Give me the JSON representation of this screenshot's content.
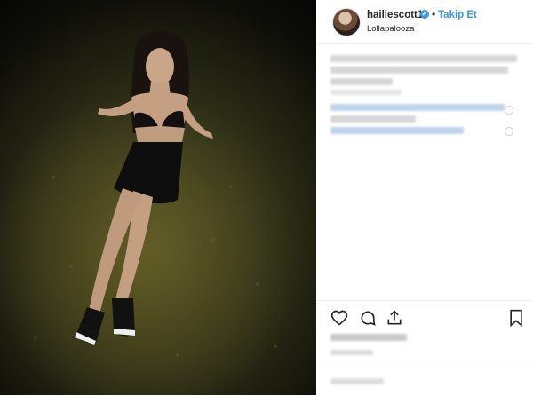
{
  "post": {
    "photo_alt": "photo-of-woman-sitting-on-grass",
    "header": {
      "username": "hailiescott1",
      "verified_badge": "✔",
      "separator": "•",
      "follow_label": "Takip Et",
      "location": "Lollapalooza"
    },
    "icons": {
      "verified": "verified-badge-icon",
      "like": "heart-icon",
      "comment": "comment-icon",
      "share": "share-icon",
      "save": "bookmark-icon"
    },
    "colors": {
      "accent": "#3897f0",
      "text": "#262626",
      "divider": "#efefef"
    }
  }
}
